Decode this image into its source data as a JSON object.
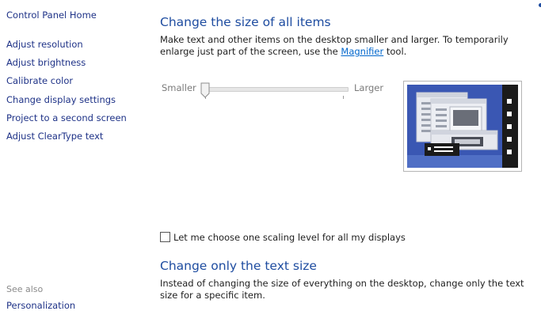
{
  "sidebar": {
    "home": "Control Panel Home",
    "items": [
      "Adjust resolution",
      "Adjust brightness",
      "Calibrate color",
      "Change display settings",
      "Project to a second screen",
      "Adjust ClearType text"
    ],
    "see_also": "See also",
    "cutoff_link": "Personalization"
  },
  "main": {
    "section1": {
      "title": "Change the size of all items",
      "desc_before": "Make text and other items on the desktop smaller and larger. To temporarily enlarge just part of the screen, use the ",
      "link": "Magnifier",
      "desc_after": " tool."
    },
    "slider": {
      "min_label": "Smaller",
      "max_label": "Larger",
      "value_fraction": 0
    },
    "checkbox": {
      "label": "Let me choose one scaling level for all my displays",
      "checked": false
    },
    "section2": {
      "title": "Change only the text size",
      "desc": "Instead of changing the size of everything on the desktop, change only the text size for a specific item."
    }
  },
  "colors": {
    "link": "#1e3287",
    "heading": "#1e4ca0",
    "preview_bg": "#3a57b3"
  },
  "icons": [
    "thumb-icon",
    "preview-illustration"
  ]
}
